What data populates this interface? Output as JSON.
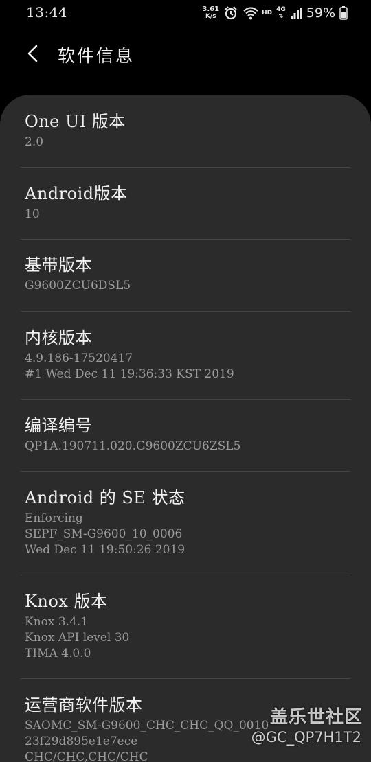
{
  "status_bar": {
    "time": "13:44",
    "net_speed_value": "3.61",
    "net_speed_unit": "K/s",
    "alarm_icon": "alarm-icon",
    "wifi_icon": "wifi-icon",
    "hd_label": "HD",
    "network_label": "4G",
    "signal_icon": "signal-icon",
    "battery_percent": "59%",
    "battery_icon": "battery-icon"
  },
  "header": {
    "back_icon": "chevron-left-icon",
    "title": "软件信息"
  },
  "items": [
    {
      "title": "One UI 版本",
      "lines": [
        "2.0"
      ]
    },
    {
      "title": "Android版本",
      "lines": [
        "10"
      ]
    },
    {
      "title": "基带版本",
      "lines": [
        "G9600ZCU6DSL5"
      ]
    },
    {
      "title": "内核版本",
      "lines": [
        "4.9.186-17520417",
        "#1 Wed Dec 11 19:36:33 KST 2019"
      ]
    },
    {
      "title": "编译编号",
      "lines": [
        "QP1A.190711.020.G9600ZCU6ZSL5"
      ]
    },
    {
      "title": "Android 的 SE 状态",
      "lines": [
        "Enforcing",
        "SEPF_SM-G9600_10_0006",
        "Wed Dec 11 19:50:26 2019"
      ]
    },
    {
      "title": "Knox 版本",
      "lines": [
        "Knox 3.4.1",
        "Knox API level 30",
        "TIMA 4.0.0"
      ]
    },
    {
      "title": "运营商软件版本",
      "lines": [
        "SAOMC_SM-G9600_CHC_CHC_QQ_0010",
        "23f29d895e1e7ece",
        "CHC/CHC,CHC/CHC"
      ]
    }
  ],
  "watermark": {
    "title": "盖乐世社区",
    "handle": "@GC_QP7H1T2"
  },
  "colors": {
    "background": "#000000",
    "card": "#2b2b2b",
    "title_text": "#f0f0f0",
    "secondary_text": "#9a9a9a",
    "divider": "#454545"
  }
}
